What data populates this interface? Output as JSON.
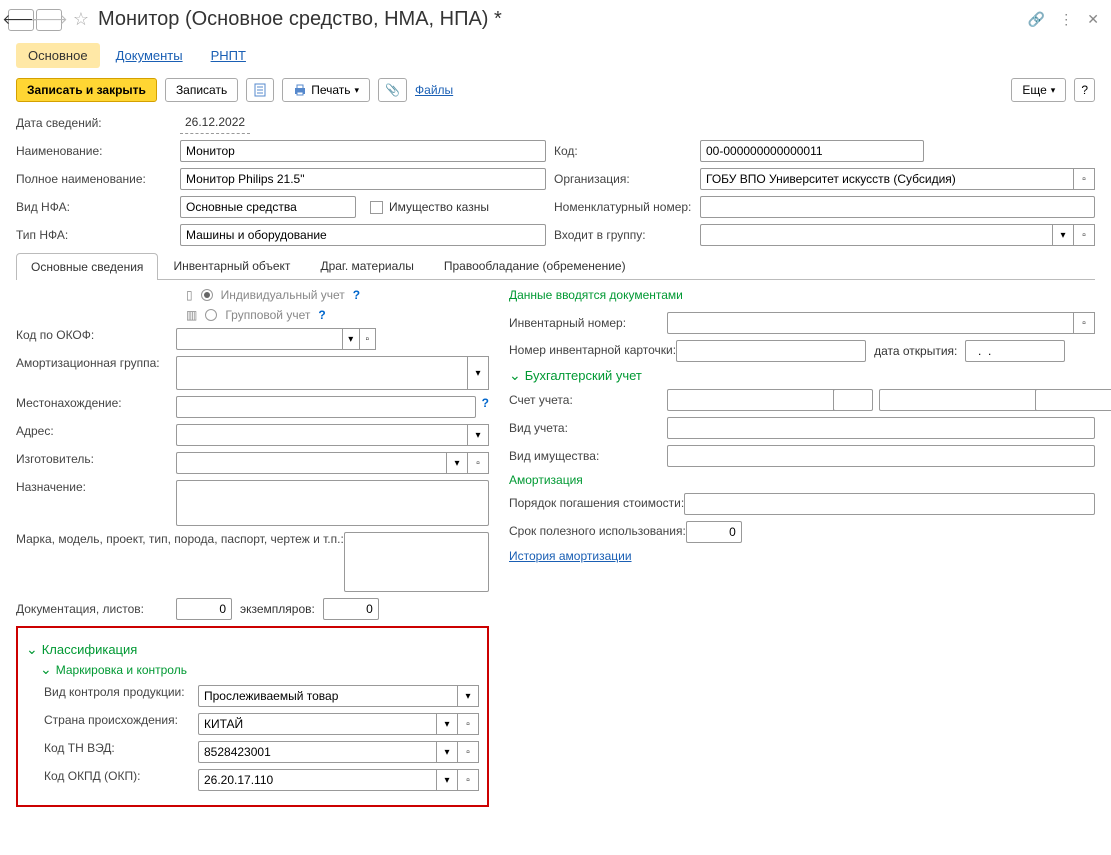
{
  "header": {
    "title": "Монитор (Основное средство, НМА, НПА) *"
  },
  "mainTabs": {
    "t1": "Основное",
    "t2": "Документы",
    "t3": "РНПТ"
  },
  "toolbar": {
    "saveClose": "Записать и закрыть",
    "save": "Записать",
    "print": "Печать",
    "files": "Файлы",
    "more": "Еще"
  },
  "form": {
    "dateLabel": "Дата сведений:",
    "dateValue": "26.12.2022",
    "nameLabel": "Наименование:",
    "nameValue": "Монитор",
    "codeLabel": "Код:",
    "codeValue": "00-000000000000011",
    "fullNameLabel": "Полное наименование:",
    "fullNameValue": "Монитор Philips 21.5\"",
    "orgLabel": "Организация:",
    "orgValue": "ГОБУ ВПО Университет искусств (Субсидия)",
    "nfaTypeLabel": "Вид НФА:",
    "nfaTypeValue": "Основные средства",
    "treasuryLabel": "Имущество казны",
    "nomLabel": "Номенклатурный номер:",
    "nfaKindLabel": "Тип НФА:",
    "nfaKindValue": "Машины и оборудование",
    "groupLabel": "Входит в группу:"
  },
  "subTabs": {
    "t1": "Основные сведения",
    "t2": "Инвентарный объект",
    "t3": "Драг. материалы",
    "t4": "Правообладание (обременение)"
  },
  "left": {
    "radioIndiv": "Индивидуальный учет",
    "radioGroup": "Групповой учет",
    "okofLabel": "Код по ОКОФ:",
    "amortGroupLabel": "Амортизационная группа:",
    "locationLabel": "Местонахождение:",
    "addressLabel": "Адрес:",
    "manufacturerLabel": "Изготовитель:",
    "purposeLabel": "Назначение:",
    "modelLabel": "Марка, модель, проект, тип, порода, паспорт, чертеж и т.п.:",
    "docsLabel": "Документация, листов:",
    "docsVal1": "0",
    "copiesLabel": "экземпляров:",
    "docsVal2": "0"
  },
  "classification": {
    "title": "Классификация",
    "subtitle": "Маркировка и контроль",
    "controlTypeLabel": "Вид контроля продукции:",
    "controlTypeValue": "Прослеживаемый товар",
    "countryLabel": "Страна происхождения:",
    "countryValue": "КИТАЙ",
    "tnvedLabel": "Код ТН ВЭД:",
    "tnvedValue": "8528423001",
    "okpdLabel": "Код ОКПД (ОКП):",
    "okpdValue": "26.20.17.110"
  },
  "right": {
    "dataByDocs": "Данные вводятся документами",
    "invNumLabel": "Инвентарный номер:",
    "invCardLabel": "Номер инвентарной карточки:",
    "openDateLabel": "дата открытия:",
    "openDateValue": "  .  .    ",
    "accounting": "Бухгалтерский учет",
    "accountLabel": "Счет учета:",
    "acctTypeLabel": "Вид учета:",
    "propTypeLabel": "Вид имущества:",
    "amort": "Амортизация",
    "repayLabel": "Порядок погашения стоимости:",
    "usefulLifeLabel": "Срок полезного использования:",
    "usefulLifeValue": "0",
    "amortHistory": "История амортизации"
  }
}
